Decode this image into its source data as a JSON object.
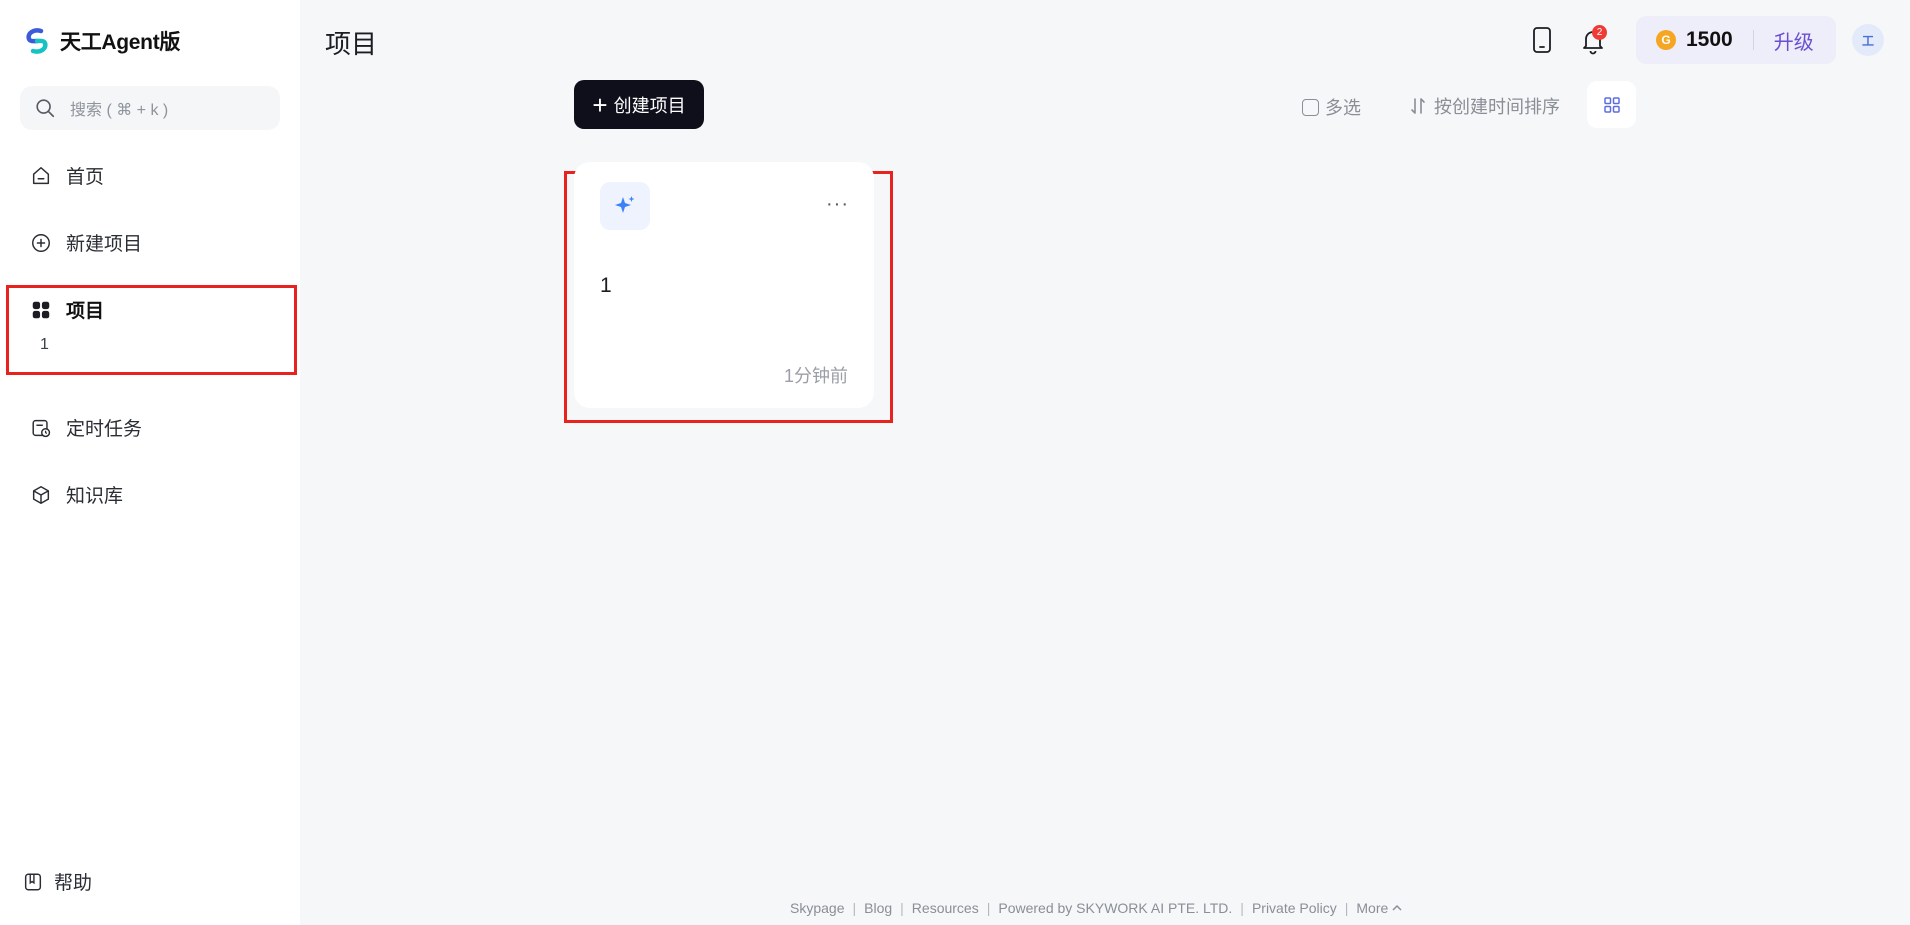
{
  "sidebar": {
    "brand": "天工Agent版",
    "search_placeholder": "搜索 ( ⌘ + k )",
    "nav": {
      "home": "首页",
      "new_project": "新建项目",
      "projects": "项目",
      "projects_sub": "1",
      "scheduled": "定时任务",
      "knowledge": "知识库"
    },
    "help": "帮助"
  },
  "header": {
    "title": "项目",
    "notification_count": "2",
    "credits": "1500",
    "upgrade": "升级",
    "avatar_text": "工"
  },
  "toolbar": {
    "create_label": "创建项目",
    "multi_select": "多选",
    "sort_label": "按创建时间排序"
  },
  "projects": [
    {
      "title": "1",
      "time": "1分钟前",
      "icon": "sparkle-icon"
    }
  ],
  "footer": {
    "links": [
      "Skypage",
      "Blog",
      "Resources",
      "Powered by SKYWORK AI PTE. LTD.",
      "Private Policy",
      "More"
    ]
  },
  "colors": {
    "accent": "#0e0f1a",
    "highlight": "#e8231f",
    "upgrade": "#6a4fd1",
    "brand_icon": "#3b82f6"
  }
}
